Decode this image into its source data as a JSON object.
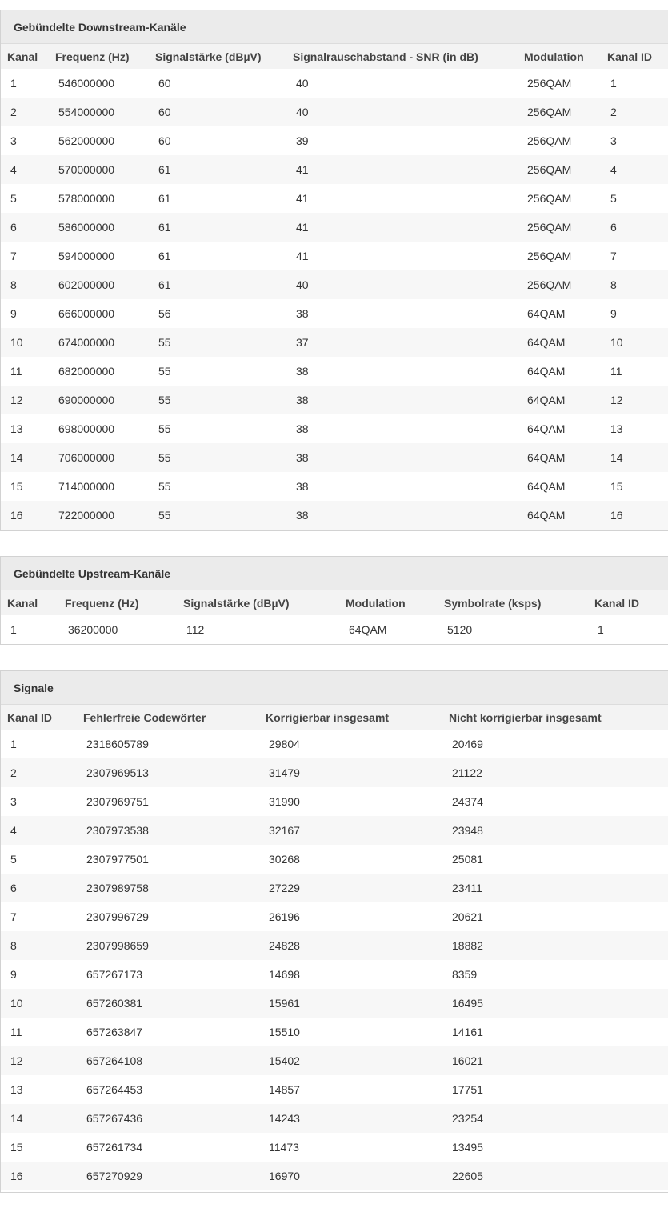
{
  "downstream": {
    "title": "Gebündelte Downstream-Kanäle",
    "headers": [
      "Kanal",
      "Frequenz (Hz)",
      "Signalstärke (dBµV)",
      "Signalrauschabstand - SNR (in dB)",
      "Modulation",
      "Kanal ID"
    ],
    "rows": [
      [
        "1",
        "546000000",
        "60",
        "40",
        "256QAM",
        "1"
      ],
      [
        "2",
        "554000000",
        "60",
        "40",
        "256QAM",
        "2"
      ],
      [
        "3",
        "562000000",
        "60",
        "39",
        "256QAM",
        "3"
      ],
      [
        "4",
        "570000000",
        "61",
        "41",
        "256QAM",
        "4"
      ],
      [
        "5",
        "578000000",
        "61",
        "41",
        "256QAM",
        "5"
      ],
      [
        "6",
        "586000000",
        "61",
        "41",
        "256QAM",
        "6"
      ],
      [
        "7",
        "594000000",
        "61",
        "41",
        "256QAM",
        "7"
      ],
      [
        "8",
        "602000000",
        "61",
        "40",
        "256QAM",
        "8"
      ],
      [
        "9",
        "666000000",
        "56",
        "38",
        "64QAM",
        "9"
      ],
      [
        "10",
        "674000000",
        "55",
        "37",
        "64QAM",
        "10"
      ],
      [
        "11",
        "682000000",
        "55",
        "38",
        "64QAM",
        "11"
      ],
      [
        "12",
        "690000000",
        "55",
        "38",
        "64QAM",
        "12"
      ],
      [
        "13",
        "698000000",
        "55",
        "38",
        "64QAM",
        "13"
      ],
      [
        "14",
        "706000000",
        "55",
        "38",
        "64QAM",
        "14"
      ],
      [
        "15",
        "714000000",
        "55",
        "38",
        "64QAM",
        "15"
      ],
      [
        "16",
        "722000000",
        "55",
        "38",
        "64QAM",
        "16"
      ]
    ]
  },
  "upstream": {
    "title": "Gebündelte Upstream-Kanäle",
    "headers": [
      "Kanal",
      "Frequenz (Hz)",
      "Signalstärke (dBµV)",
      "Modulation",
      "Symbolrate (ksps)",
      "Kanal ID"
    ],
    "rows": [
      [
        "1",
        "36200000",
        "112",
        "64QAM",
        "5120",
        "1"
      ]
    ]
  },
  "signals": {
    "title": "Signale",
    "headers": [
      "Kanal ID",
      "Fehlerfreie Codewörter",
      "Korrigierbar insgesamt",
      "Nicht korrigierbar insgesamt"
    ],
    "rows": [
      [
        "1",
        "2318605789",
        "29804",
        "20469"
      ],
      [
        "2",
        "2307969513",
        "31479",
        "21122"
      ],
      [
        "3",
        "2307969751",
        "31990",
        "24374"
      ],
      [
        "4",
        "2307973538",
        "32167",
        "23948"
      ],
      [
        "5",
        "2307977501",
        "30268",
        "25081"
      ],
      [
        "6",
        "2307989758",
        "27229",
        "23411"
      ],
      [
        "7",
        "2307996729",
        "26196",
        "20621"
      ],
      [
        "8",
        "2307998659",
        "24828",
        "18882"
      ],
      [
        "9",
        "657267173",
        "14698",
        "8359"
      ],
      [
        "10",
        "657260381",
        "15961",
        "16495"
      ],
      [
        "11",
        "657263847",
        "15510",
        "14161"
      ],
      [
        "12",
        "657264108",
        "15402",
        "16021"
      ],
      [
        "13",
        "657264453",
        "14857",
        "17751"
      ],
      [
        "14",
        "657267436",
        "14243",
        "23254"
      ],
      [
        "15",
        "657261734",
        "11473",
        "13495"
      ],
      [
        "16",
        "657270929",
        "16970",
        "22605"
      ]
    ]
  }
}
